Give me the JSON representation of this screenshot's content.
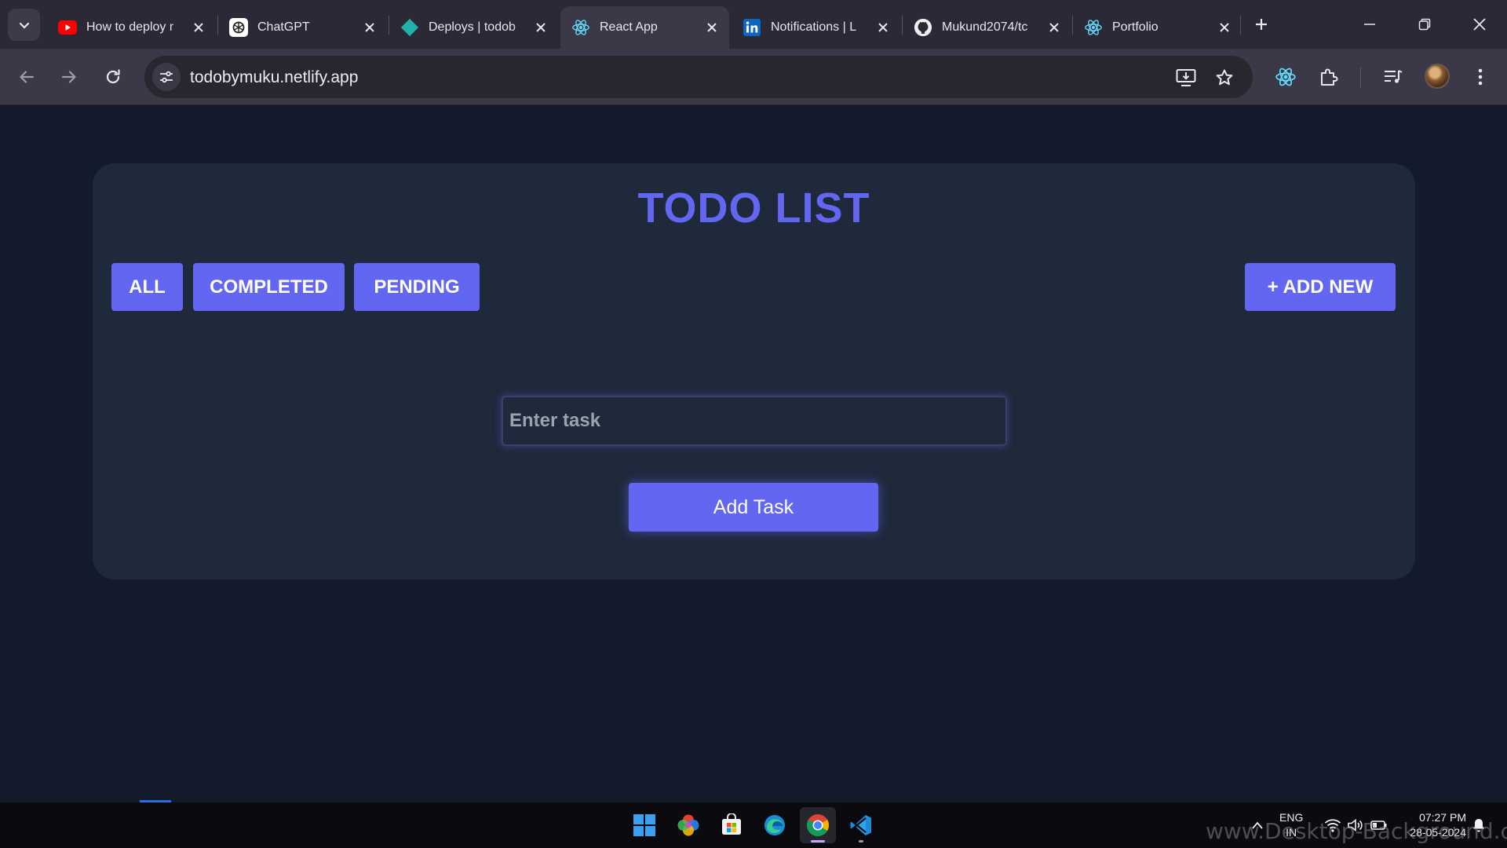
{
  "browser": {
    "tabs": [
      {
        "title": "How to deploy r",
        "favicon": "youtube-icon",
        "active": false
      },
      {
        "title": "ChatGPT",
        "favicon": "chatgpt-icon",
        "active": false
      },
      {
        "title": "Deploys | todob",
        "favicon": "netlify-icon",
        "active": false
      },
      {
        "title": "React App",
        "favicon": "react-icon",
        "active": true
      },
      {
        "title": "Notifications | L",
        "favicon": "linkedin-icon",
        "active": false
      },
      {
        "title": "Mukund2074/tc",
        "favicon": "github-icon",
        "active": false
      },
      {
        "title": "Portfolio",
        "favicon": "react-icon",
        "active": false
      }
    ],
    "url": "todobymuku.netlify.app",
    "colors": {
      "tabstrip": "#2b2936",
      "toolbar": "#3b3947",
      "omnibox": "#28262f"
    }
  },
  "app": {
    "title": "TODO LIST",
    "filters": [
      {
        "label": "ALL"
      },
      {
        "label": "COMPLETED"
      },
      {
        "label": "PENDING"
      }
    ],
    "add_new_label": "+ ADD NEW",
    "task_input": {
      "placeholder": "Enter task",
      "value": ""
    },
    "add_task_label": "Add Task",
    "colors": {
      "accent": "#6366f1",
      "card": "#1e293b",
      "background": "#121a2c"
    }
  },
  "taskbar": {
    "apps": [
      "windows-start-icon",
      "photos-icon",
      "store-icon",
      "edge-icon",
      "chrome-icon",
      "vscode-icon"
    ],
    "active_app": "chrome-icon",
    "language": {
      "line1": "ENG",
      "line2": "IN"
    },
    "time": "07:27 PM",
    "date": "28-05-2024"
  },
  "watermark": "www.Desktop-Background.com"
}
